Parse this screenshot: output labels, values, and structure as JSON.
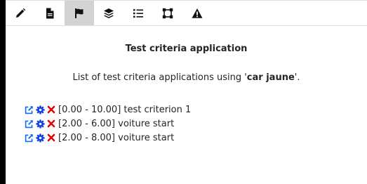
{
  "toolbar": {
    "tools": [
      {
        "icon": "pencil-icon",
        "active": false
      },
      {
        "icon": "document-icon",
        "active": false
      },
      {
        "icon": "flag-icon",
        "active": true
      },
      {
        "icon": "layers-icon",
        "active": false
      },
      {
        "icon": "list-icon",
        "active": false
      },
      {
        "icon": "vector-square-icon",
        "active": false
      },
      {
        "icon": "warning-icon",
        "active": false
      }
    ]
  },
  "main": {
    "title": "Test criteria application",
    "subtitle_prefix": "List of test criteria applications using '",
    "subtitle_bold": "car jaune",
    "subtitle_suffix": "'.",
    "rows": [
      {
        "text": "[0.00 - 10.00] test criterion 1"
      },
      {
        "text": "[2.00 - 6.00] voiture start"
      },
      {
        "text": "[2.00 - 8.00] voiture start"
      }
    ]
  },
  "colors": {
    "link_blue": "#0d6efd",
    "gear_blue": "#1040e0",
    "delete_red": "#e00000",
    "active_tab": "#d3d3d3"
  }
}
